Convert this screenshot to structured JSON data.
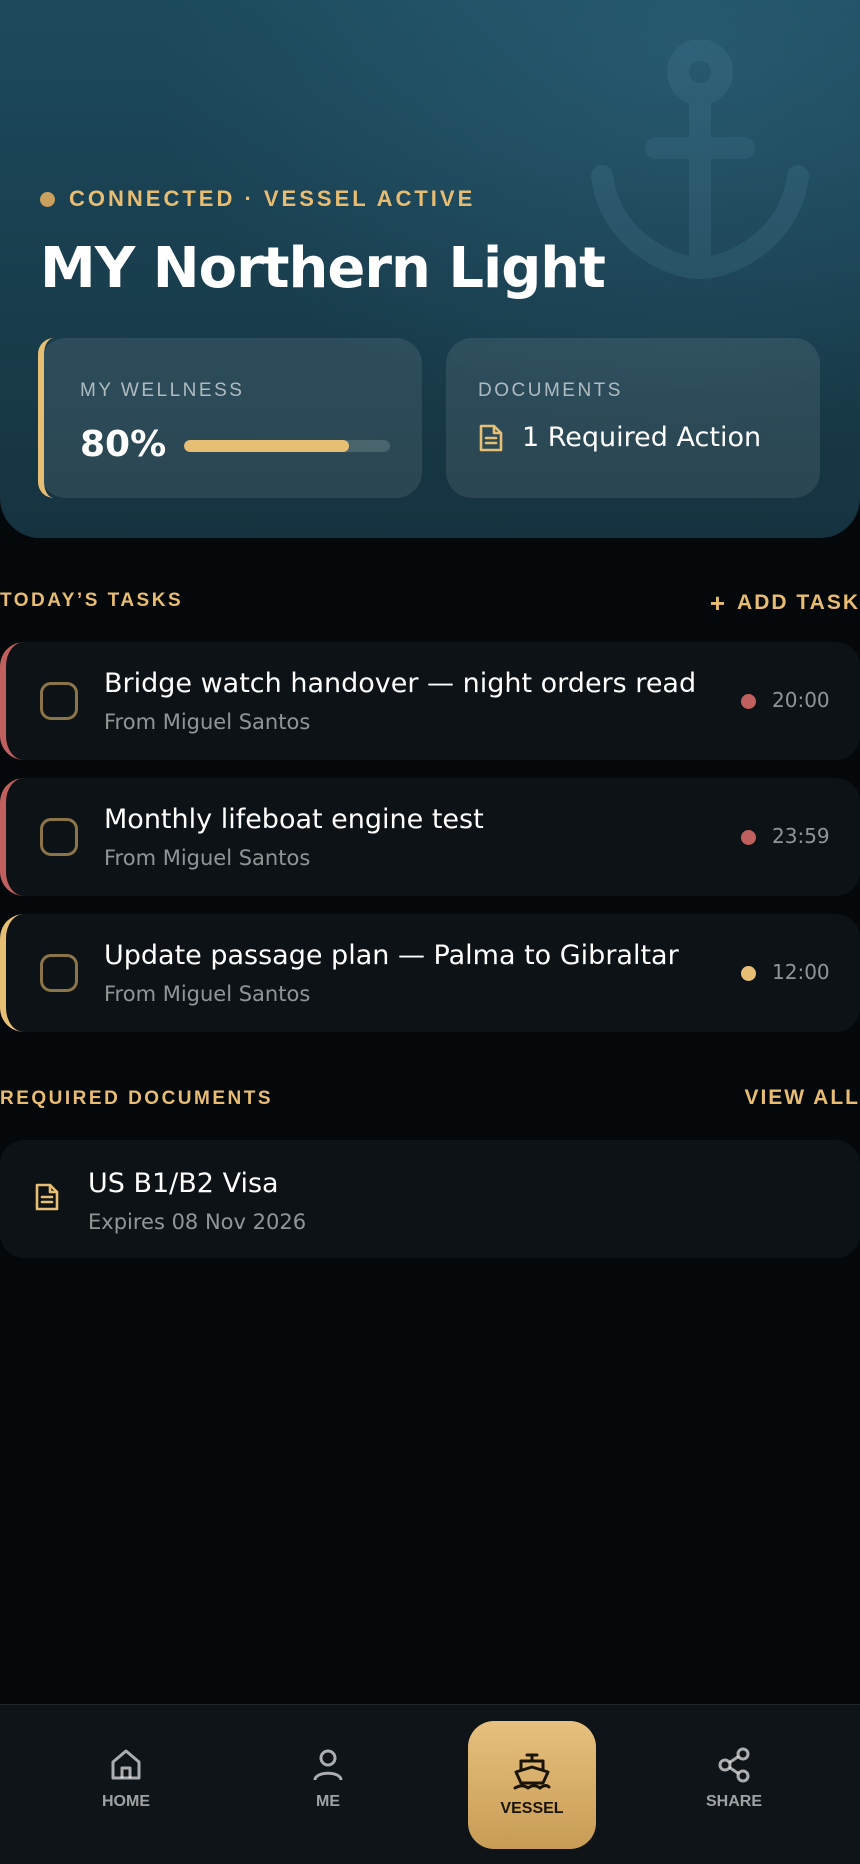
{
  "hero": {
    "status": "CONNECTED · VESSEL ACTIVE",
    "vessel_name": "MY Northern Light",
    "wellness": {
      "label": "MY WELLNESS",
      "value": "80%",
      "progress": 0.8
    },
    "documents": {
      "label": "DOCUMENTS",
      "action": "1 Required Action"
    }
  },
  "tasks_section": {
    "title": "TODAY’S TASKS",
    "add_label": "ADD TASK",
    "items": [
      {
        "title": "Bridge watch handover — night orders read",
        "from": "From Miguel Santos",
        "time": "20:00",
        "color": "#c0605e"
      },
      {
        "title": "Monthly lifeboat engine test",
        "from": "From Miguel Santos",
        "time": "23:59",
        "color": "#c0605e"
      },
      {
        "title": "Update passage plan — Palma to Gibraltar",
        "from": "From Miguel Santos",
        "time": "12:00",
        "color": "#e6be74"
      }
    ]
  },
  "documents_section": {
    "title": "REQUIRED DOCUMENTS",
    "view_all": "VIEW ALL",
    "items": [
      {
        "title": "US B1/B2 Visa",
        "expires": "Expires 08 Nov 2026"
      }
    ]
  },
  "nav": {
    "home": "HOME",
    "me": "ME",
    "vessel": "VESSEL",
    "share": "SHARE"
  },
  "colors": {
    "accent": "#e6be74",
    "urgent": "#c0605e",
    "background": "#05080b"
  }
}
